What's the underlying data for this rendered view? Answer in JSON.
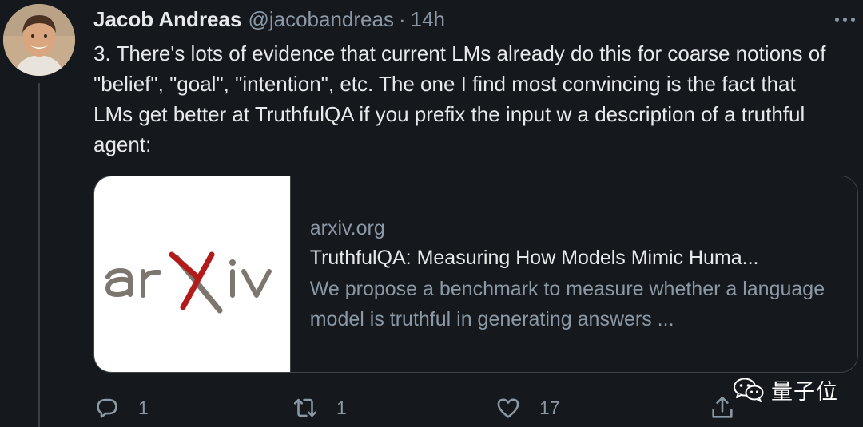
{
  "tweet": {
    "author_name": "Jacob Andreas",
    "handle": "@jacobandreas",
    "separator": "·",
    "time": "14h",
    "text": "3. There's lots of evidence that current LMs already do this for coarse notions of \"belief\", \"goal\", \"intention\", etc. The one I find most convincing is the fact that LMs get better at TruthfulQA if you prefix the input w a description of a truthful agent:"
  },
  "card": {
    "logo_text": "arXiv",
    "domain": "arxiv.org",
    "title": "TruthfulQA: Measuring How Models Mimic Huma...",
    "description": "We propose a benchmark to measure whether a language model is truthful in generating answers ..."
  },
  "actions": {
    "reply_count": "1",
    "retweet_count": "1",
    "like_count": "17"
  },
  "watermark": {
    "text": "量子位"
  },
  "icons": {
    "avatar": "avatar",
    "more": "more-icon",
    "reply": "reply-icon",
    "retweet": "retweet-icon",
    "like": "heart-icon",
    "share": "share-icon",
    "watermark": "wechat-icon"
  },
  "colors": {
    "background": "#15181c",
    "text": "#e7e9ea",
    "secondary": "#8b98a5",
    "arxiv_red": "#b31b1b",
    "arxiv_gray": "#7d766e"
  }
}
